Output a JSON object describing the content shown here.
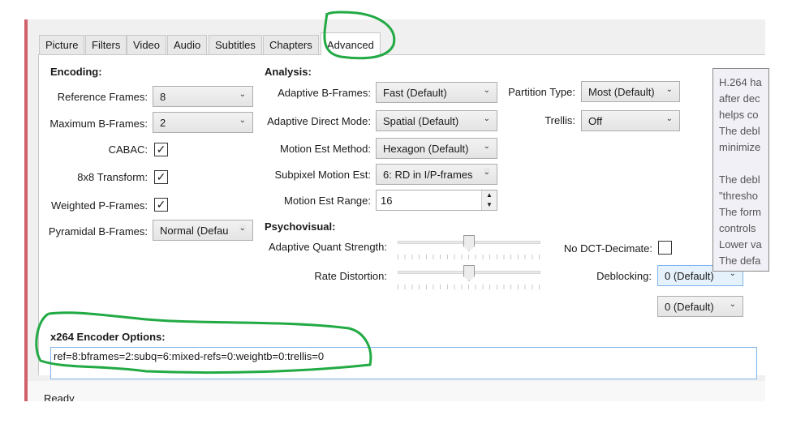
{
  "tabs": [
    "Picture",
    "Filters",
    "Video",
    "Audio",
    "Subtitles",
    "Chapters",
    "Advanced"
  ],
  "active_tab": "Advanced",
  "encoding": {
    "heading": "Encoding:",
    "reference_frames": {
      "label": "Reference Frames:",
      "value": "8"
    },
    "max_bframes": {
      "label": "Maximum B-Frames:",
      "value": "2"
    },
    "cabac": {
      "label": "CABAC:",
      "checked": true
    },
    "transform8x8": {
      "label": "8x8 Transform:",
      "checked": true
    },
    "weighted_p": {
      "label": "Weighted P-Frames:",
      "checked": true
    },
    "pyramidal_b": {
      "label": "Pyramidal B-Frames:",
      "value": "Normal (Defau"
    }
  },
  "analysis": {
    "heading": "Analysis:",
    "adaptive_b": {
      "label": "Adaptive B-Frames:",
      "value": "Fast (Default)"
    },
    "adaptive_direct": {
      "label": "Adaptive Direct Mode:",
      "value": "Spatial (Default)"
    },
    "me_method": {
      "label": "Motion Est Method:",
      "value": "Hexagon (Default)"
    },
    "subpixel_me": {
      "label": "Subpixel Motion Est:",
      "value": "6: RD in I/P-frames"
    },
    "me_range": {
      "label": "Motion Est Range:",
      "value": "16"
    },
    "partition": {
      "label": "Partition Type:",
      "value": "Most (Default)"
    },
    "trellis": {
      "label": "Trellis:",
      "value": "Off"
    }
  },
  "psychovisual": {
    "heading": "Psychovisual:",
    "aq_strength": {
      "label": "Adaptive Quant Strength:",
      "level": 0.5
    },
    "rate_distortion": {
      "label": "Rate Distortion:",
      "level": 0.5
    },
    "no_dct_decimate": {
      "label": "No DCT-Decimate:",
      "checked": false
    },
    "deblocking": {
      "label": "Deblocking:",
      "value1": "0 (Default)",
      "value2": "0 (Default)"
    }
  },
  "tooltip": "H.264 ha\nafter dec\nhelps co\nThe debl\nminimize\n\nThe debl\n\"thresho\nThe form\ncontrols \nLower va\nThe defa",
  "x264": {
    "heading": "x264 Encoder Options:",
    "value": "ref=8:bframes=2:subq=6:mixed-refs=0:weightb=0:trellis=0"
  },
  "status": "Ready",
  "colors": {
    "annotation": "#22aa44",
    "accent": "#7eb4ea"
  },
  "icons": {
    "dropdown": "chevron-down-icon",
    "check": "checkmark-icon"
  }
}
